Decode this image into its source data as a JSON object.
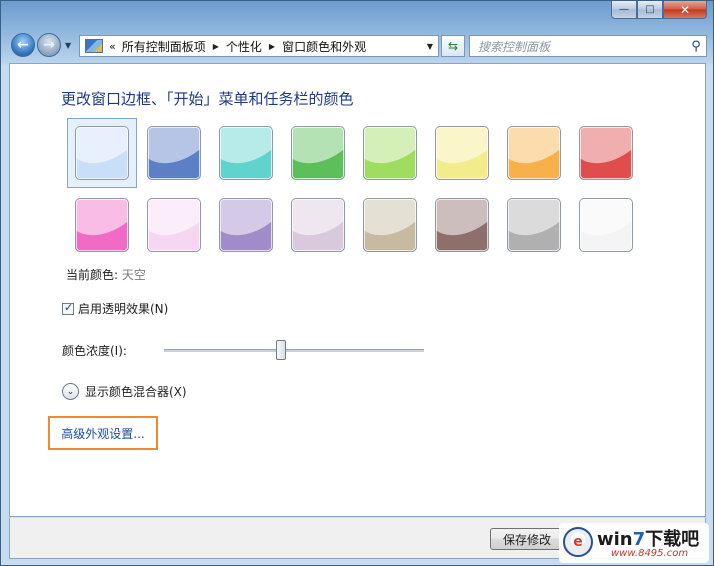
{
  "window": {
    "caption_buttons": {
      "minimize": "—",
      "maximize": "□",
      "close": "✕"
    }
  },
  "nav": {
    "breadcrumb_lead": "«",
    "breadcrumbs": [
      "所有控制面板项",
      "个性化",
      "窗口颜色和外观"
    ],
    "search_placeholder": "搜索控制面板"
  },
  "content": {
    "title": "更改窗口边框、「开始」菜单和任务栏的颜色",
    "swatches": [
      {
        "color": "#c9def8",
        "selected": true
      },
      {
        "color": "#5d7fc6"
      },
      {
        "color": "#61d3cf"
      },
      {
        "color": "#5cbf5a"
      },
      {
        "color": "#9fdc5f"
      },
      {
        "color": "#f3ec8b"
      },
      {
        "color": "#f8b14a"
      },
      {
        "color": "#df4d4d"
      },
      {
        "color": "#f06ac6"
      },
      {
        "color": "#f6d7f1"
      },
      {
        "color": "#a18bc9"
      },
      {
        "color": "#d9c9dc"
      },
      {
        "color": "#c6bba1"
      },
      {
        "color": "#8d6f6c"
      },
      {
        "color": "#b0b0b0"
      },
      {
        "color": "#f4f4f4"
      }
    ],
    "current_color_label": "当前颜色:",
    "current_color_name": "天空",
    "transparency_label": "启用透明效果(N)",
    "transparency_checked": true,
    "intensity_label": "颜色浓度(I):",
    "intensity_value": 0.45,
    "mixer_label": "显示颜色混合器(X)",
    "advanced_link": "高级外观设置..."
  },
  "footer": {
    "save_label": "保存修改"
  },
  "watermark": {
    "brand_prefix": "win",
    "brand_seven": "7",
    "brand_suffix": "下载吧",
    "url": "www.8495.com"
  }
}
